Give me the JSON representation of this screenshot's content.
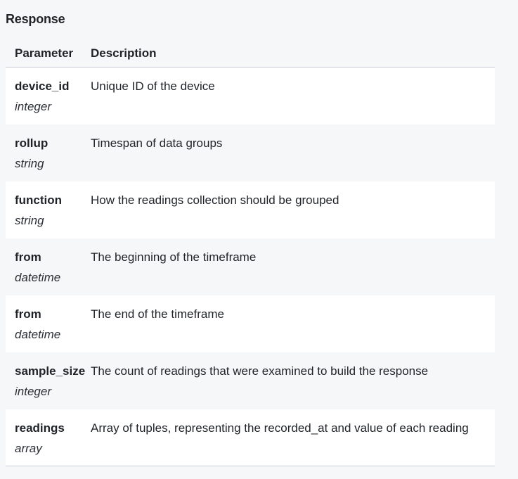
{
  "section": {
    "title": "Response"
  },
  "table": {
    "headers": {
      "parameter": "Parameter",
      "description": "Description"
    },
    "rows": [
      {
        "name": "device_id",
        "type": "integer",
        "description": "Unique ID of the device"
      },
      {
        "name": "rollup",
        "type": "string",
        "description": "Timespan of data groups"
      },
      {
        "name": "function",
        "type": "string",
        "description": "How the readings collection should be grouped"
      },
      {
        "name": "from",
        "type": "datetime",
        "description": "The beginning of the timeframe"
      },
      {
        "name": "from",
        "type": "datetime",
        "description": "The end of the timeframe"
      },
      {
        "name": "sample_size",
        "type": "integer",
        "description": "The count of readings that were examined to build the response"
      },
      {
        "name": "readings",
        "type": "array",
        "description": "Array of tuples, representing the recorded_at and value of each reading"
      }
    ]
  },
  "colors": {
    "page_background": "#f6f7f9",
    "row_background": "#ffffff",
    "border": "#c9ced6",
    "text": "#1f2328"
  }
}
